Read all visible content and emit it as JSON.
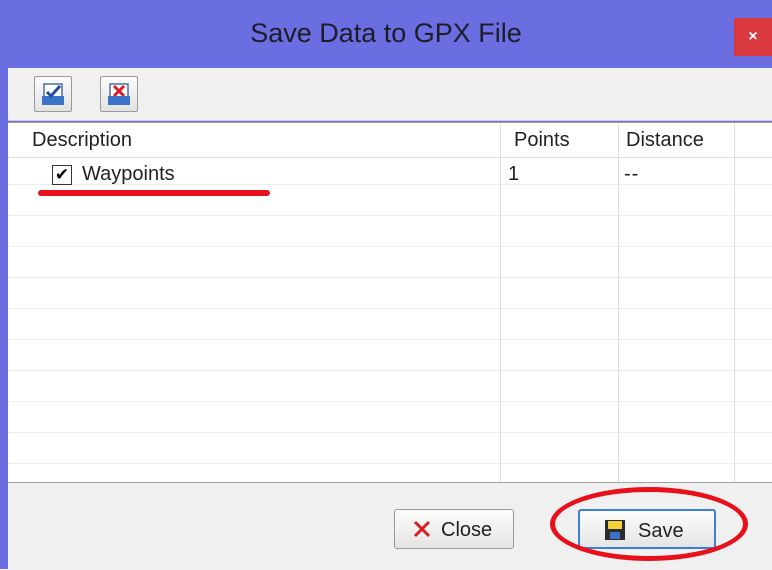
{
  "window": {
    "title": "Save Data to GPX File",
    "close_glyph": "×"
  },
  "toolbar": {
    "buttons": [
      {
        "icon": "check-all-icon"
      },
      {
        "icon": "uncheck-all-icon"
      }
    ]
  },
  "table": {
    "columns": [
      "Description",
      "Points",
      "Distance"
    ],
    "rows": [
      {
        "checked": true,
        "description": "Waypoints",
        "points": "1",
        "distance": "--"
      }
    ]
  },
  "footer": {
    "close_label": "Close",
    "save_label": "Save"
  },
  "colors": {
    "titlebar": "#6b6ee0",
    "close_button": "#d9383e",
    "annotation": "#e8111b"
  }
}
